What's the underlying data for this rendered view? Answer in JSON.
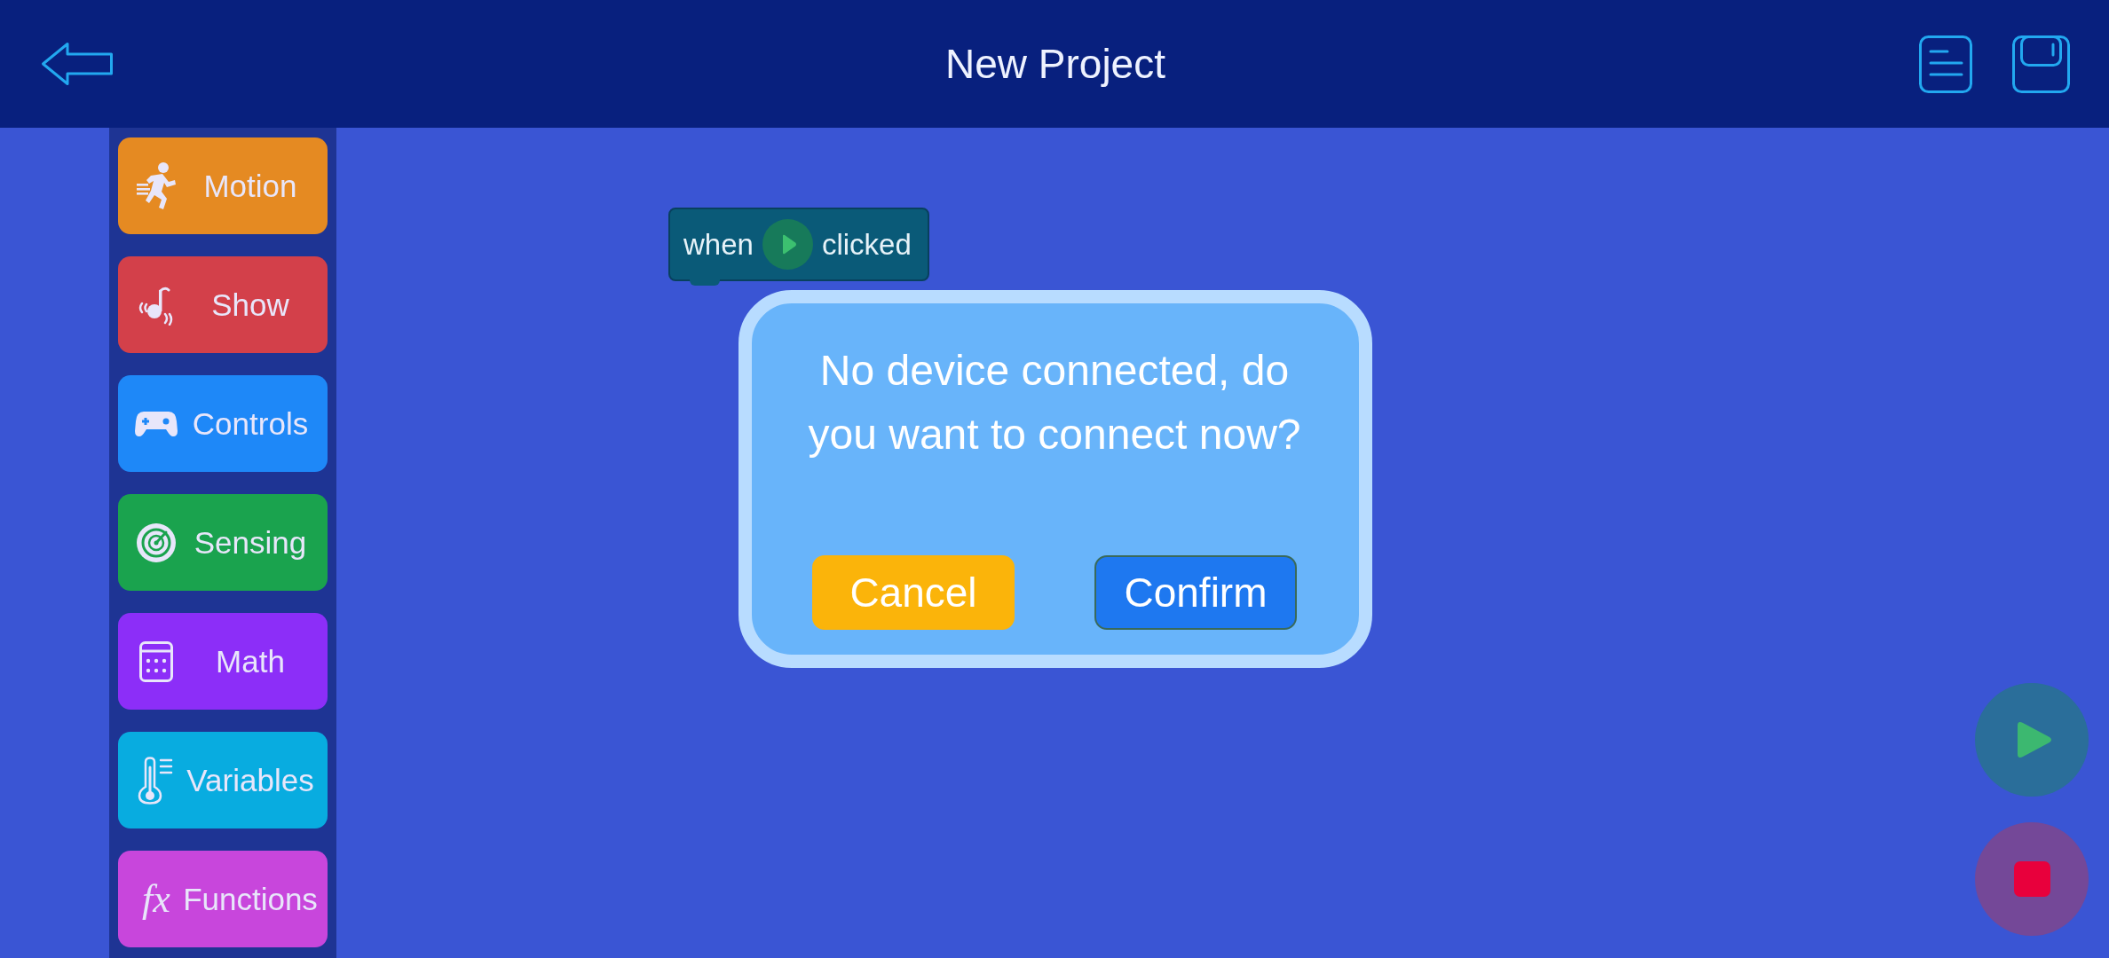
{
  "header": {
    "title": "New Project"
  },
  "categories": [
    {
      "label": "Motion",
      "color": "#e58a22"
    },
    {
      "label": "Show",
      "color": "#d3404a"
    },
    {
      "label": "Controls",
      "color": "#1e88f8"
    },
    {
      "label": "Sensing",
      "color": "#1aa34e"
    },
    {
      "label": "Math",
      "color": "#8c2ef8"
    },
    {
      "label": "Variables",
      "color": "#08ace0"
    },
    {
      "label": "Functions",
      "color": "#c846dc",
      "icon_text": "fx"
    }
  ],
  "canvas": {
    "blocks": [
      {
        "kind": "hat",
        "parts": [
          {
            "kind": "text",
            "text": "when"
          },
          {
            "kind": "flag"
          },
          {
            "kind": "text",
            "text": "clicked"
          }
        ]
      }
    ]
  },
  "dialog": {
    "message": "No device connected, do you want to connect now?",
    "buttons": [
      {
        "kind": "cancel",
        "label": "Cancel"
      },
      {
        "kind": "confirm",
        "label": "Confirm"
      }
    ]
  }
}
